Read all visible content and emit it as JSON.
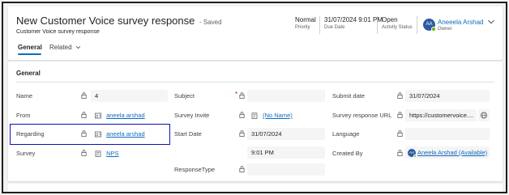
{
  "header": {
    "title": "New Customer Voice survey response",
    "saved_status": "- Saved",
    "subtitle": "Customer Voice survey response",
    "priority_value": "Normal",
    "priority_label": "Priority",
    "due_date_value": "31/07/2024 9:01 PM",
    "due_date_label": "Due Date",
    "activity_status_value": "Open",
    "activity_status_label": "Activity Status",
    "owner_initials": "AA",
    "owner_name": "Aneeela Arshad",
    "owner_label": "Owner"
  },
  "tabs": [
    {
      "label": "General",
      "selected": true
    },
    {
      "label": "Related",
      "selected": false
    }
  ],
  "section": {
    "title": "General"
  },
  "fields": {
    "name": {
      "label": "Name",
      "value": "4"
    },
    "from": {
      "label": "From",
      "value": "aneela arshad"
    },
    "regarding": {
      "label": "Regarding",
      "value": "aneela arshad"
    },
    "survey": {
      "label": "Survey",
      "value": "NPS"
    },
    "subject": {
      "label": "Subject",
      "required": "*",
      "value": ""
    },
    "survey_invite": {
      "label": "Survey Invite",
      "value": "(No Name)"
    },
    "start_date": {
      "label": "Start Date",
      "date": "31/07/2024",
      "time": "9:01 PM"
    },
    "response_type": {
      "label": "ResponseType",
      "value": ""
    },
    "submit_date": {
      "label": "Submit date",
      "value": "31/07/2024"
    },
    "survey_response_url": {
      "label": "Survey response URL",
      "value": "https://customervoice...."
    },
    "language": {
      "label": "Language",
      "value": ""
    },
    "created_by": {
      "label": "Created By",
      "initials": "AA",
      "value": "Aneela Arshad (Available)"
    }
  },
  "colors": {
    "accent": "#0f6cbd",
    "focus_border": "#1010b8",
    "avatar": "#2d5aa4",
    "presence": "#6bb700"
  },
  "icons": [
    "chevron-down-icon",
    "lock-icon",
    "user-record-icon",
    "survey-icon",
    "globe-icon"
  ]
}
